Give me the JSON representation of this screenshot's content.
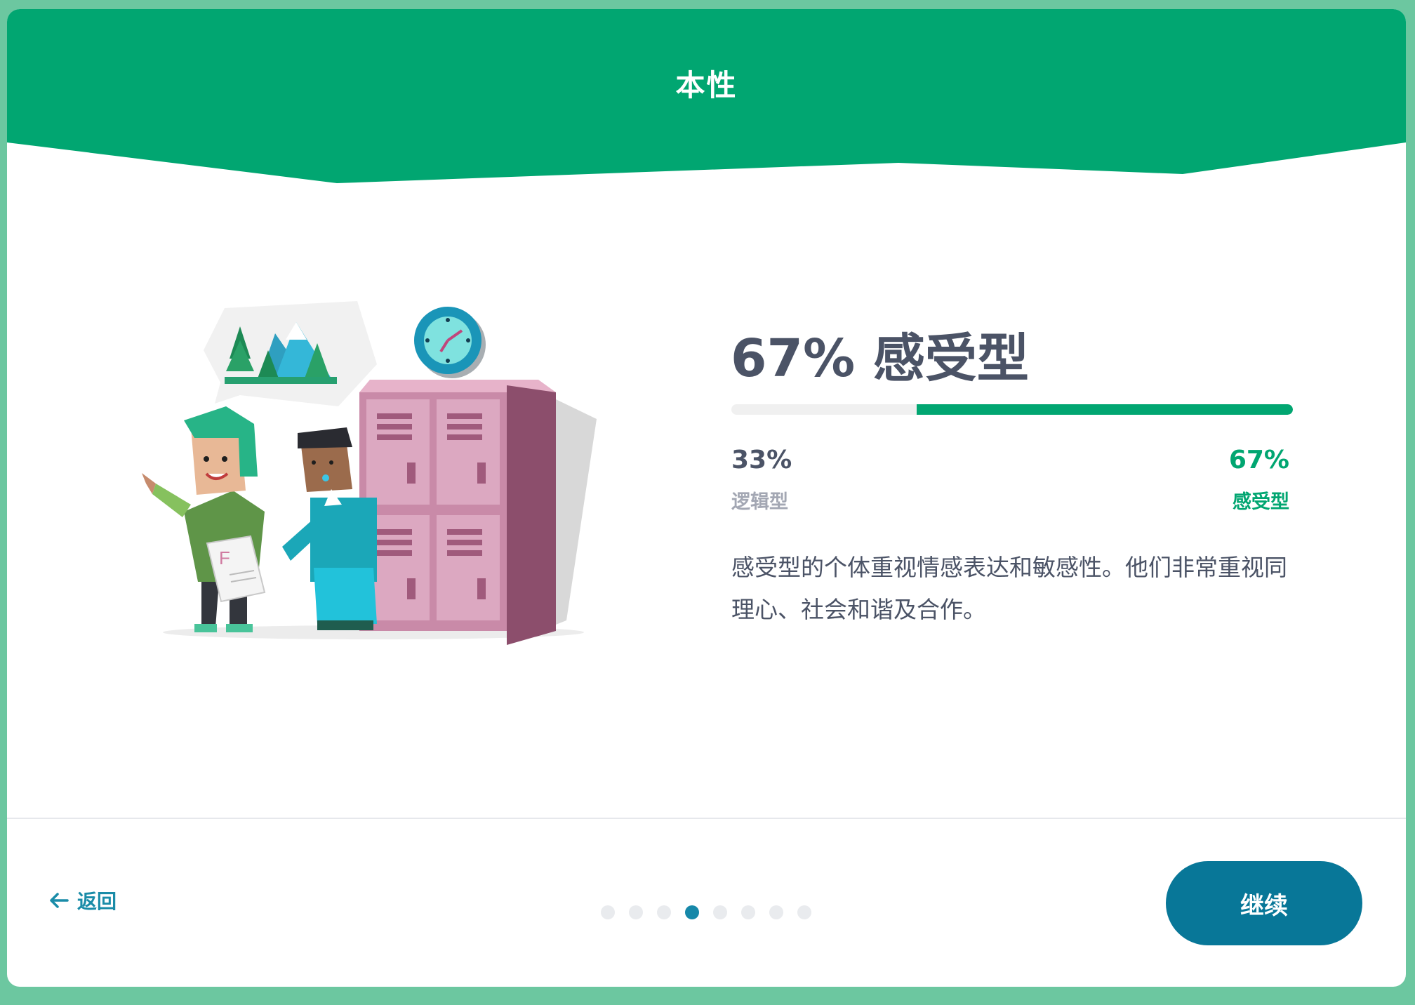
{
  "header": {
    "title": "本性"
  },
  "result": {
    "heading": "67% 感受型",
    "progress_fraction": 0.67,
    "left_percent": "33%",
    "left_label": "逻辑型",
    "right_percent": "67%",
    "right_label": "感受型",
    "description": "感受型的个体重视情感表达和敏感性。他们非常重视同理心、社会和谐及合作。"
  },
  "footer": {
    "back_label": "返回",
    "continue_label": "继续",
    "page_count": 8,
    "current_page": 4
  },
  "colors": {
    "header_green": "#01a671",
    "accent_green": "#01a671",
    "heading_text": "#4b5366",
    "button_blue": "#087798",
    "link_blue": "#1a8ca8",
    "active_dot": "#1688a9"
  },
  "icons": {
    "back": "arrow-left-icon"
  }
}
